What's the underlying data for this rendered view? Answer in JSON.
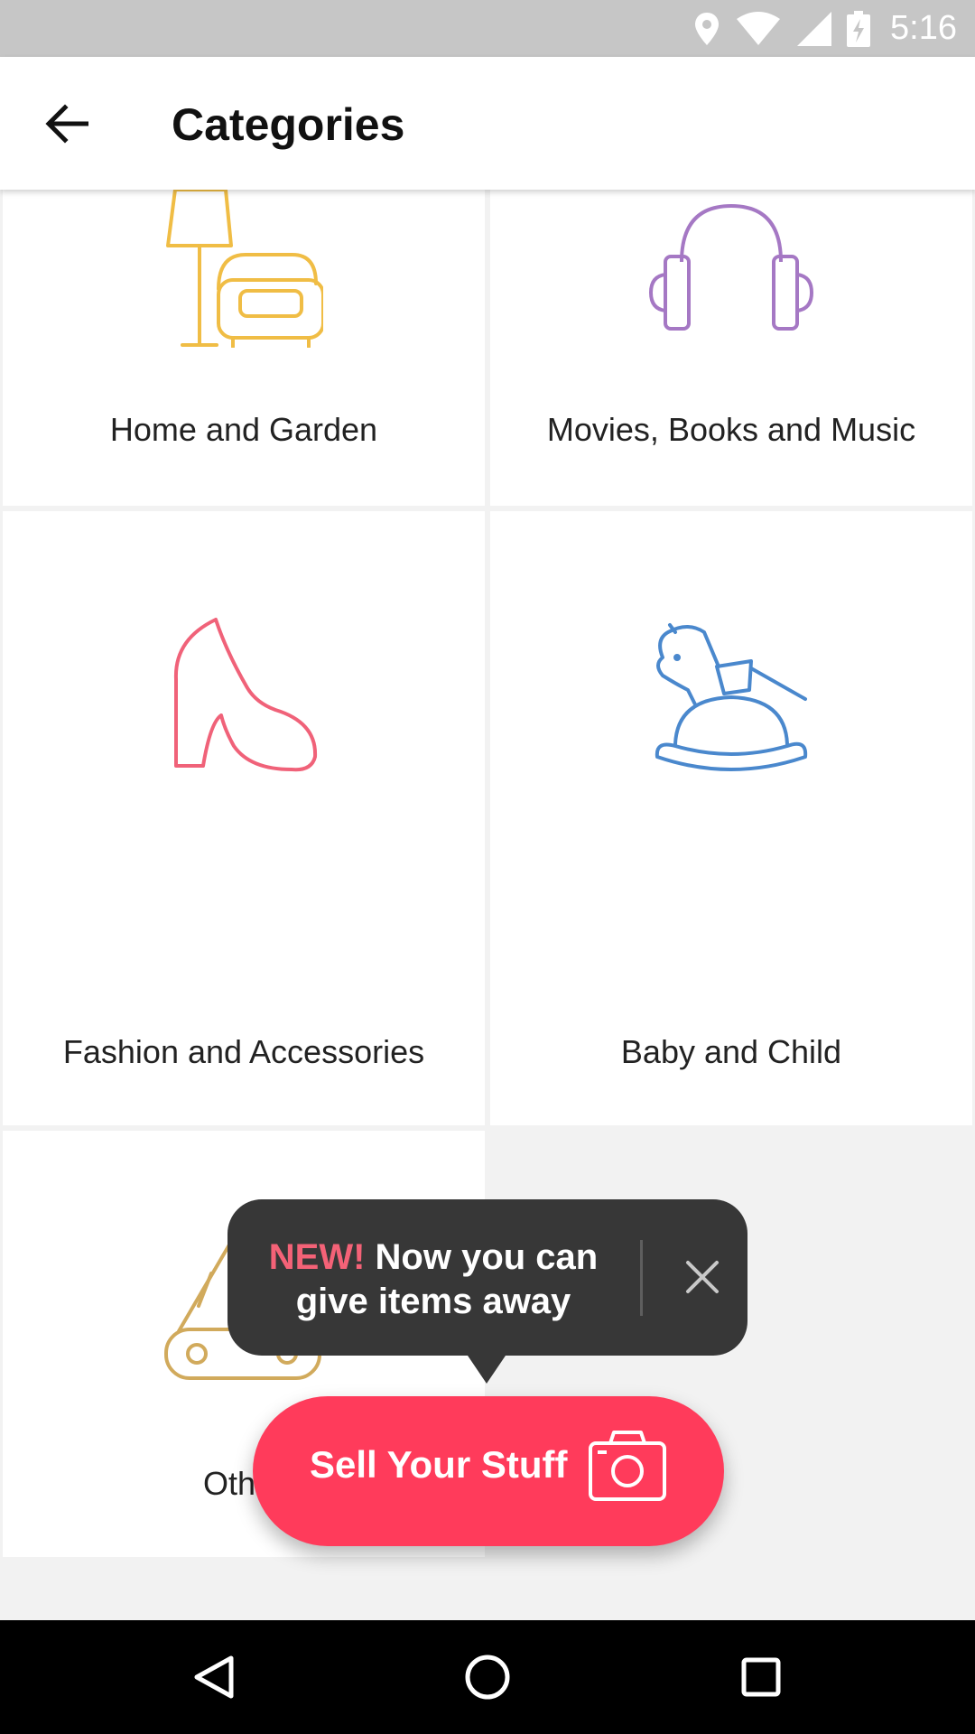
{
  "status_bar": {
    "time": "5:16",
    "icons": [
      "location-icon",
      "wifi-icon",
      "cell-signal-icon",
      "battery-charging-icon"
    ]
  },
  "app_bar": {
    "title": "Categories",
    "back_icon": "arrow-left-icon"
  },
  "categories": [
    {
      "label": "Home and Garden",
      "icon": "lamp-armchair-icon",
      "color": "#f0bd45"
    },
    {
      "label": "Movies, Books and Music",
      "icon": "headphones-icon",
      "color": "#a578c4"
    },
    {
      "label": "Fashion and Accessories",
      "icon": "high-heel-icon",
      "color": "#f06279"
    },
    {
      "label": "Baby and Child",
      "icon": "rocking-horse-icon",
      "color": "#4a88cd"
    },
    {
      "label": "Other",
      "icon": "pocket-knife-icon",
      "color": "#d1aa5c"
    }
  ],
  "tooltip": {
    "new_label": "NEW!",
    "text_line1": " Now you can",
    "text_line2": "give items away",
    "close_icon": "close-icon"
  },
  "fab": {
    "label": "Sell Your Stuff",
    "icon": "camera-icon",
    "color": "#ff3b5b"
  },
  "nav_bar": {
    "buttons": [
      "back-triangle-icon",
      "home-circle-icon",
      "recents-square-icon"
    ]
  }
}
